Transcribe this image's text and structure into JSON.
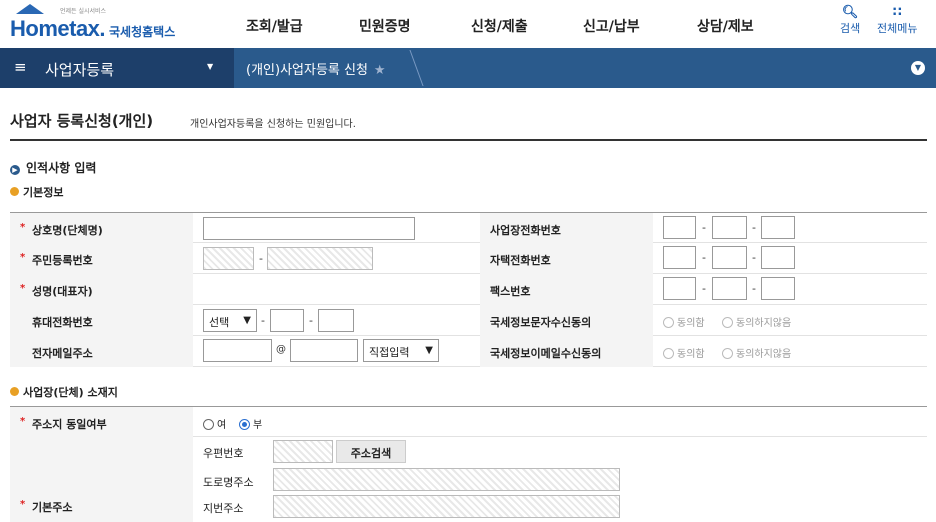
{
  "header": {
    "logo_tagline": "언제든 실시서비스",
    "logo_text": "Hometax.",
    "logo_sub": "국세청홈택스",
    "menu": [
      "조회/발급",
      "민원증명",
      "신청/제출",
      "신고/납부",
      "상담/제보"
    ],
    "search_label": "검색",
    "allmenu_label": "전체메뉴"
  },
  "nav": {
    "section": "사업자등록",
    "breadcrumb": "(개인)사업자등록 신청"
  },
  "page": {
    "title": "사업자 등록신청(개인)",
    "description": "개인사업자등록을 신청하는 민원입니다."
  },
  "personal_section": {
    "heading": "인적사항 입력",
    "basic_heading": "기본정보",
    "labels": {
      "trade_name": "상호명(단체명)",
      "resident_number": "주민등록번호",
      "name": "성명(대표자)",
      "mobile": "휴대전화번호",
      "email": "전자메일주소",
      "business_phone": "사업장전화번호",
      "home_phone": "자택전화번호",
      "fax": "팩스번호",
      "sms_consent": "국세정보문자수신동의",
      "email_consent": "국세정보이메일수신동의"
    },
    "mobile_select": "선택",
    "email_at": "@",
    "email_domain_select": "직접입력",
    "agree": "동의함",
    "disagree": "동의하지않음"
  },
  "address_section": {
    "heading": "사업장(단체) 소재지",
    "same_address_label": "주소지 동일여부",
    "yes": "여",
    "no": "부",
    "basic_address_label": "기본주소",
    "postal_code_label": "우편번호",
    "address_search_button": "주소검색",
    "road_address_label": "도로명주소",
    "lot_address_label": "지번주소"
  },
  "colors": {
    "nav_dark": "#1d3f6a",
    "nav": "#2a5a8c",
    "brand": "#1a5cad",
    "required": "#dd2222",
    "section_dot": "#e8a025"
  },
  "icons": [
    "home-roof-icon",
    "search-icon",
    "grid-icon",
    "menu-icon",
    "star-icon",
    "chevron-down-icon",
    "arrow-right-icon",
    "bullet-icon"
  ]
}
